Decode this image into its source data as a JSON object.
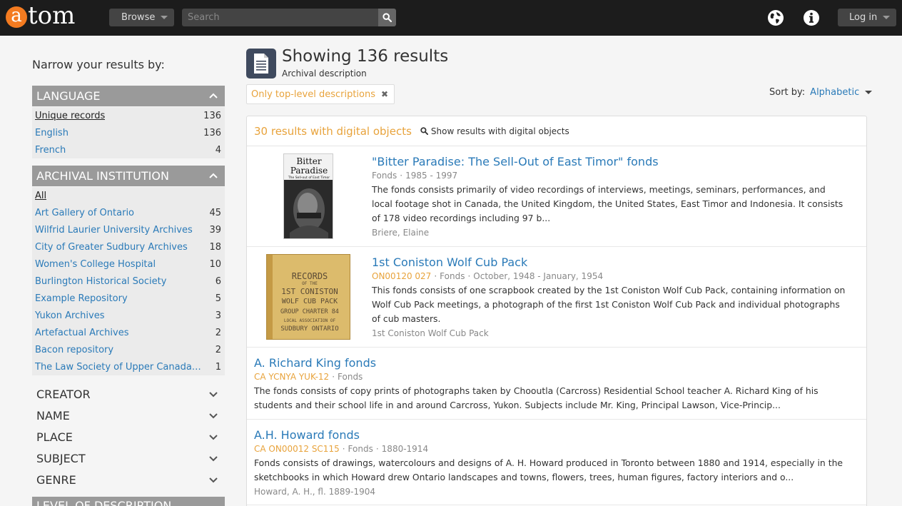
{
  "header": {
    "logo_first": "a",
    "logo_rest": "tom",
    "browse_label": "Browse",
    "search_placeholder": "Search",
    "login_label": "Log in"
  },
  "sidebar": {
    "narrow_title": "Narrow your results by:",
    "language": {
      "title": "LANGUAGE",
      "items": [
        {
          "label": "Unique records",
          "count": "136"
        },
        {
          "label": "English",
          "count": "136"
        },
        {
          "label": "French",
          "count": "4"
        }
      ]
    },
    "institution": {
      "title": "ARCHIVAL INSTITUTION",
      "items": [
        {
          "label": "All",
          "count": ""
        },
        {
          "label": "Art Gallery of Ontario",
          "count": "45"
        },
        {
          "label": "Wilfrid Laurier University Archives",
          "count": "39"
        },
        {
          "label": "City of Greater Sudbury Archives",
          "count": "18"
        },
        {
          "label": "Women's College Hospital",
          "count": "10"
        },
        {
          "label": "Burlington Historical Society",
          "count": "6"
        },
        {
          "label": "Example Repository",
          "count": "5"
        },
        {
          "label": "Yukon Archives",
          "count": "3"
        },
        {
          "label": "Artefactual Archives",
          "count": "2"
        },
        {
          "label": "Bacon repository",
          "count": "2"
        },
        {
          "label": "The Law Society of Upper Canada Archives",
          "count": "1"
        }
      ]
    },
    "collapsed": [
      "CREATOR",
      "NAME",
      "PLACE",
      "SUBJECT",
      "GENRE"
    ],
    "partial_facet": "LEVEL OF DESCRIPTION"
  },
  "main": {
    "title": "Showing 136 results",
    "subtitle": "Archival description",
    "filter_tag": "Only top-level descriptions",
    "sort_label": "Sort by:",
    "sort_value": "Alphabetic",
    "digital_count": "30 results with digital objects",
    "show_digital": "Show results with digital objects",
    "results": [
      {
        "title": "\"Bitter Paradise: The Sell-Out of East Timor\" fonds",
        "ref": "",
        "level": "Fonds",
        "dates": "1985 - 1997",
        "desc": "The fonds consists primarily of video recordings of interviews, meetings, seminars, performances, and local footage shot in Canada, the United Kingdom, the United States, East Timor and Indonesia. It consists of 178 video recordings including 97 b...",
        "creator": "Briere, Elaine",
        "thumb_text_1": "Bitter",
        "thumb_text_2": "Paradise",
        "thumb_text_3": "The Sell-out of East Timor"
      },
      {
        "title": "1st Coniston Wolf Cub Pack",
        "ref": "ON00120 027",
        "level": "Fonds",
        "dates": "October, 1948 - January, 1954",
        "desc": "This fonds consists of one scrapbook created by the 1st Coniston Wolf Cub Pack, containing information on Wolf Cub Pack meetings, a photograph of the first 1st Coniston Wolf Cub Pack and individual photographs of cub masters.",
        "creator": "1st Coniston Wolf Cub Pack",
        "thumb_lines": [
          "RECORDS",
          "OF THE",
          "1ST CONISTON",
          "WOLF CUB PACK",
          "GROUP CHARTER 84",
          "LOCAL ASSOCIATION OF",
          "SUDBURY ONTARIO"
        ]
      },
      {
        "title": "A. Richard King fonds",
        "ref": "CA YCNYA YUK-12",
        "level": "Fonds",
        "dates": "",
        "desc": "The fonds consists of copy prints of photographs taken by Chooutla (Carcross) Residential School teacher A. Richard King of his students and their school life in and around Carcross, Yukon. Subjects include Mr. King, Principal Lawson, Vice-Princip...",
        "creator": ""
      },
      {
        "title": "A.H. Howard fonds",
        "ref": "CA ON00012 SC115",
        "level": "Fonds",
        "dates": "1880-1914",
        "desc": "Fonds consists of drawings, watercolours and designs of A. H. Howard produced in Toronto between 1880 and 1914, especially in the sketchbooks in which Howard drew Ontario landscapes and towns, flowers, trees, human figures, factory interiors and o...",
        "creator": "Howard, A. H., fl. 1889-1904"
      }
    ]
  }
}
